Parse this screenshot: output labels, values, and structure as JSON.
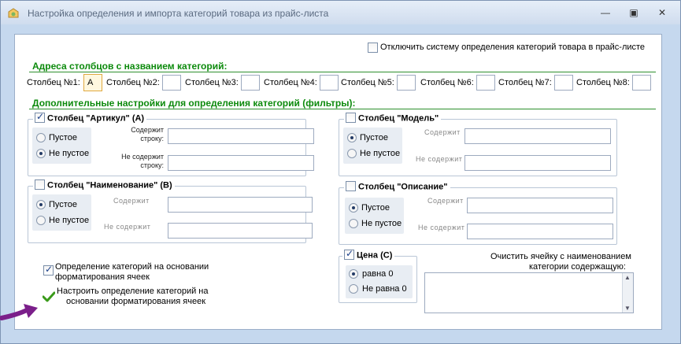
{
  "window": {
    "title": "Настройка определения и импорта категорий товара из прайс-листа",
    "minimize_glyph": "—",
    "maximize_glyph": "▣",
    "close_glyph": "✕"
  },
  "top_checkbox": {
    "label": "Отключить систему определения категорий товара в прайс-листе",
    "checked": false
  },
  "addresses": {
    "title": "Адреса столбцов с названием категорий:",
    "columns": [
      {
        "label": "Столбец №1:",
        "value": "A"
      },
      {
        "label": "Столбец №2:",
        "value": ""
      },
      {
        "label": "Столбец №3:",
        "value": ""
      },
      {
        "label": "Столбец №4:",
        "value": ""
      },
      {
        "label": "Столбец №5:",
        "value": ""
      },
      {
        "label": "Столбец №6:",
        "value": ""
      },
      {
        "label": "Столбец №7:",
        "value": ""
      },
      {
        "label": "Столбец №8:",
        "value": ""
      }
    ]
  },
  "filters": {
    "title": "Дополнительные настройки для определения категорий (фильтры):",
    "article": {
      "legend": "Столбец \"Артикул\" (A)",
      "checked": true,
      "empty": "Пустое",
      "not_empty": "Не пустое",
      "contains": "Содержит строку:",
      "not_contains": "Не содержит строку:"
    },
    "model": {
      "legend": "Столбец \"Модель\"",
      "checked": false,
      "empty": "Пустое",
      "not_empty": "Не пустое",
      "contains": "Содержит",
      "not_contains": "Не содержит"
    },
    "name": {
      "legend": "Столбец \"Наименование\" (B)",
      "checked": false,
      "empty": "Пустое",
      "not_empty": "Не пустое",
      "contains": "Содержит",
      "not_contains": "Не содержит"
    },
    "description": {
      "legend": "Столбец \"Описание\"",
      "checked": false,
      "empty": "Пустое",
      "not_empty": "Не пустое",
      "contains": "Содержит",
      "not_contains": "Не содержит"
    },
    "price": {
      "legend": "Цена (C)",
      "checked": true,
      "equal_zero": "равна 0",
      "not_equal_zero": "Не равна 0"
    }
  },
  "format_checkbox": {
    "label_line1": "Определение категорий на основании",
    "label_line2": "форматирования ячеек",
    "checked": true
  },
  "format_link": {
    "label_line1": "Настроить определение категорий на",
    "label_line2": "основании форматирования ячеек"
  },
  "clear_cell": {
    "label_line1": "Очистить ячейку с наименованием",
    "label_line2": "категории содержащую:",
    "value": ""
  },
  "colors": {
    "section_green": "#0c8a0c",
    "arrow_purple": "#7b1f8a",
    "check_green": "#3a9a1a"
  }
}
